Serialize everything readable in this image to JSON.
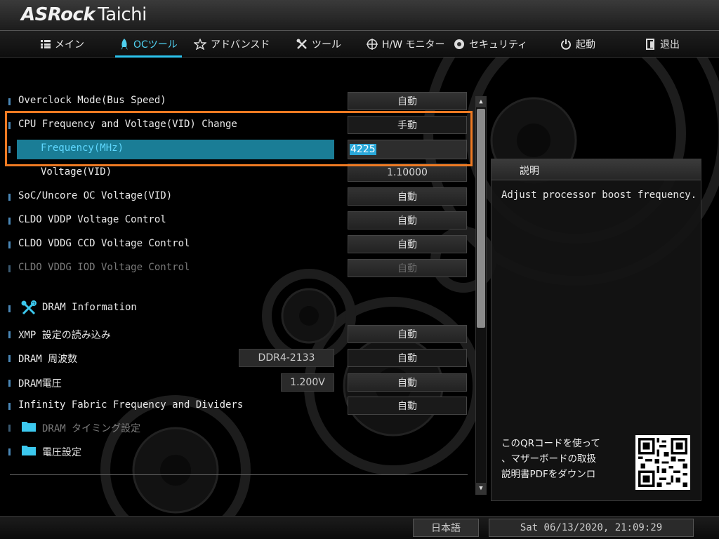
{
  "header": {
    "brand": "ASRock",
    "model": "Taichi"
  },
  "menu": {
    "tabs": [
      {
        "label": "メイン",
        "icon": "list-icon"
      },
      {
        "label": "OCツール",
        "icon": "rocket-icon",
        "active": true
      },
      {
        "label": "アドバンスド",
        "icon": "star-icon"
      },
      {
        "label": "ツール",
        "icon": "tools-icon"
      },
      {
        "label": "H/W モニター",
        "icon": "crosshair-icon"
      },
      {
        "label": "セキュリティ",
        "icon": "shield-icon"
      },
      {
        "label": "起動",
        "icon": "power-icon"
      },
      {
        "label": "退出",
        "icon": "exit-icon"
      }
    ]
  },
  "settings": {
    "overclock_mode": {
      "label": "Overclock Mode(Bus Speed)",
      "value": "自動"
    },
    "cpu_freq_change": {
      "label": "CPU Frequency and Voltage(VID) Change",
      "value": "手動"
    },
    "frequency": {
      "label": "Frequency(MHz)",
      "value": "4225"
    },
    "voltage": {
      "label": "Voltage(VID)",
      "value": "1.10000"
    },
    "soc_uncore": {
      "label": "SoC/Uncore OC Voltage(VID)",
      "value": "自動"
    },
    "cldo_vddp": {
      "label": "CLDO VDDP Voltage Control",
      "value": "自動"
    },
    "cldo_vddg_ccd": {
      "label": "CLDO VDDG CCD Voltage Control",
      "value": "自動"
    },
    "cldo_vddg_iod": {
      "label": "CLDO VDDG IOD Voltage Control",
      "value": "自動"
    },
    "dram_info": {
      "label": "DRAM Information"
    },
    "xmp": {
      "label": "XMP 設定の読み込み",
      "value": "自動"
    },
    "dram_freq": {
      "label": "DRAM 周波数",
      "current": "DDR4-2133",
      "value": "自動"
    },
    "dram_voltage": {
      "label": "DRAM電圧",
      "current": "1.200V",
      "value": "自動"
    },
    "infinity_fabric": {
      "label": "Infinity Fabric Frequency and Dividers",
      "value": "自動"
    },
    "dram_timing": {
      "label": "DRAM タイミング設定"
    },
    "voltage_settings": {
      "label": "電圧設定"
    }
  },
  "description": {
    "title": "説明",
    "text": "Adjust processor boost frequency.",
    "qr_line1": "このQRコードを使って",
    "qr_line2": "、マザーボードの取扱",
    "qr_line3": "説明書PDFをダウンロ"
  },
  "status": {
    "language": "日本語",
    "datetime": "Sat 06/13/2020, 21:09:29"
  },
  "colors": {
    "accent": "#2cc4ee",
    "selection": "#1a7d96",
    "highlight_frame": "#ee7a22"
  }
}
